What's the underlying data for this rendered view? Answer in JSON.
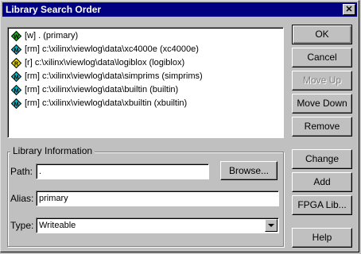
{
  "window": {
    "title": "Library Search Order",
    "close_glyph": "✕"
  },
  "list": {
    "items": [
      {
        "icon": "w-green-diamond-icon",
        "badge": "W",
        "color": "#22aa22",
        "text": "[w] . (primary)"
      },
      {
        "icon": "m-cyan-diamond-icon",
        "badge": "M",
        "color": "#00b8c8",
        "text": "[rm] c:\\xilinx\\viewlog\\data\\xc4000e (xc4000e)"
      },
      {
        "icon": "r-yellow-diamond-icon",
        "badge": "R",
        "color": "#e8d800",
        "text": "[r] c:\\xilinx\\viewlog\\data\\logiblox (logiblox)"
      },
      {
        "icon": "m-cyan-diamond-icon",
        "badge": "M",
        "color": "#00b8c8",
        "text": "[rm] c:\\xilinx\\viewlog\\data\\simprims (simprims)"
      },
      {
        "icon": "m-cyan-diamond-icon",
        "badge": "M",
        "color": "#00b8c8",
        "text": "[rm] c:\\xilinx\\viewlog\\data\\builtin (builtin)"
      },
      {
        "icon": "m-cyan-diamond-icon",
        "badge": "M",
        "color": "#00b8c8",
        "text": "[rm] c:\\xilinx\\viewlog\\data\\xbuiltin (xbuiltin)"
      }
    ]
  },
  "buttons": {
    "ok": "OK",
    "cancel": "Cancel",
    "move_up": "Move Up",
    "move_down": "Move Down",
    "remove": "Remove",
    "change": "Change",
    "add": "Add",
    "fpga_lib": "FPGA Lib...",
    "help": "Help",
    "browse": "Browse..."
  },
  "library_info": {
    "group_title": "Library Information",
    "path_label": "Path:",
    "path_value": ".",
    "alias_label": "Alias:",
    "alias_value": "primary",
    "type_label": "Type:",
    "type_value": "Writeable"
  }
}
